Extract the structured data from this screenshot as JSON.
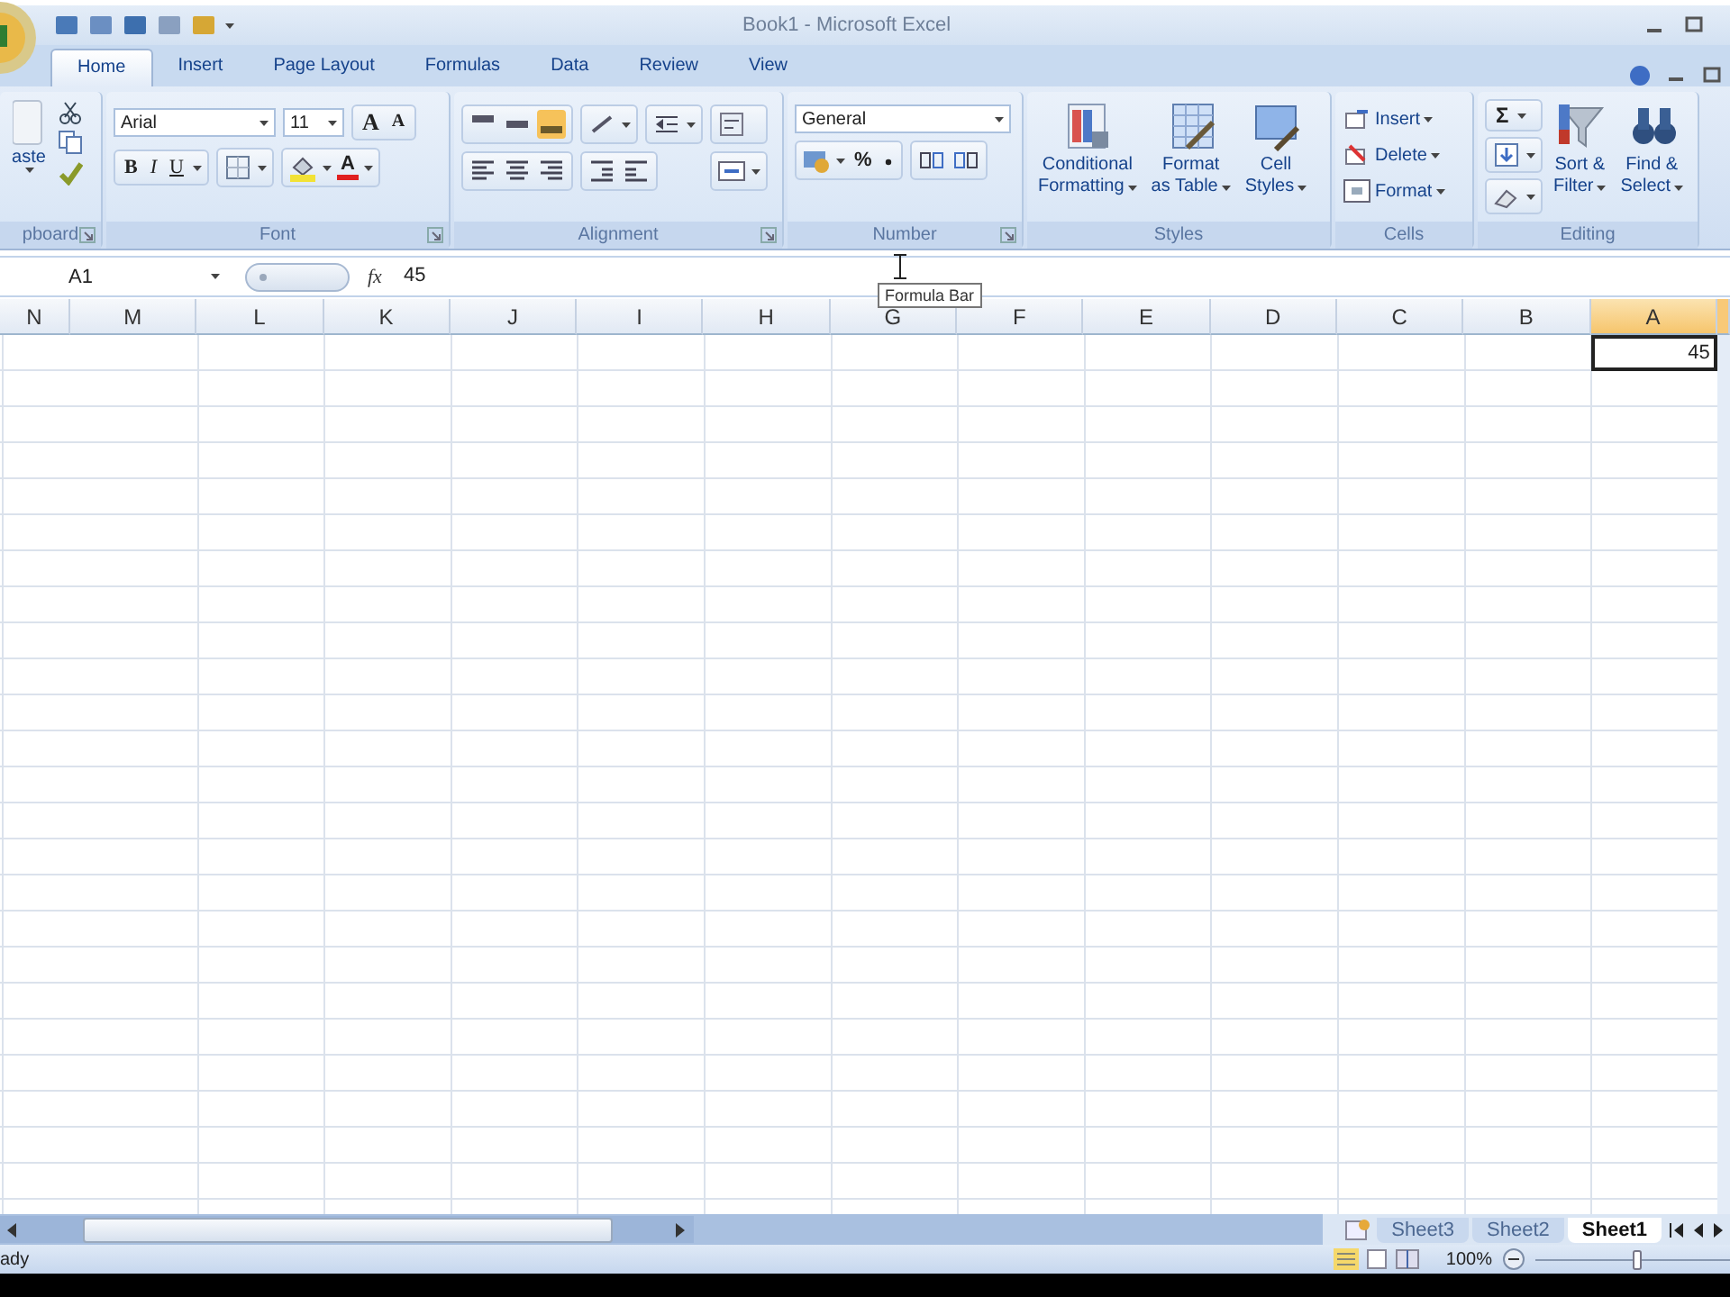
{
  "window": {
    "title": "Book1 - Microsoft Excel"
  },
  "ribbon_tabs": [
    {
      "label": "Home",
      "selected": true
    },
    {
      "label": "Insert",
      "selected": false
    },
    {
      "label": "Page Layout",
      "selected": false
    },
    {
      "label": "Formulas",
      "selected": false
    },
    {
      "label": "Data",
      "selected": false
    },
    {
      "label": "Review",
      "selected": false
    },
    {
      "label": "View",
      "selected": false
    }
  ],
  "clipboard": {
    "paste_label": "aste",
    "group_label": "pboard"
  },
  "font": {
    "name": "Arial",
    "size": "11",
    "grow": "A",
    "shrink": "A",
    "bold": "B",
    "italic": "I",
    "underline": "U",
    "font_color": "A",
    "group_label": "Font"
  },
  "alignment": {
    "group_label": "Alignment"
  },
  "number": {
    "format": "General",
    "percent": "%",
    "group_label": "Number"
  },
  "styles": {
    "buttons": [
      {
        "lines": [
          "Conditional",
          "Formatting"
        ]
      },
      {
        "lines": [
          "Format",
          "as Table"
        ]
      },
      {
        "lines": [
          "Cell",
          "Styles"
        ]
      }
    ],
    "group_label": "Styles"
  },
  "cells": {
    "buttons": [
      "Insert",
      "Delete",
      "Format"
    ],
    "group_label": "Cells"
  },
  "editing": {
    "sum": "Σ",
    "buttons": [
      {
        "lines": [
          "Sort &",
          "Filter"
        ]
      },
      {
        "lines": [
          "Find &",
          "Select"
        ]
      }
    ],
    "group_label": "Editing"
  },
  "formula_bar": {
    "name_box": "A1",
    "fx": "fx",
    "value": "45"
  },
  "tooltip": "Formula Bar",
  "columns": [
    {
      "label": "N",
      "selected": false
    },
    {
      "label": "M",
      "selected": false
    },
    {
      "label": "L",
      "selected": false
    },
    {
      "label": "K",
      "selected": false
    },
    {
      "label": "J",
      "selected": false
    },
    {
      "label": "I",
      "selected": false
    },
    {
      "label": "H",
      "selected": false
    },
    {
      "label": "G",
      "selected": false
    },
    {
      "label": "F",
      "selected": false
    },
    {
      "label": "E",
      "selected": false
    },
    {
      "label": "D",
      "selected": false
    },
    {
      "label": "C",
      "selected": false
    },
    {
      "label": "B",
      "selected": false
    },
    {
      "label": "A",
      "selected": true
    }
  ],
  "active_cell": {
    "value": "45"
  },
  "sheet_tabs": [
    {
      "label": "Sheet3",
      "selected": false
    },
    {
      "label": "Sheet2",
      "selected": false
    },
    {
      "label": "Sheet1",
      "selected": true
    }
  ],
  "status_bar": {
    "text": "ady",
    "zoom": "100%",
    "zoom_slider": {
      "level": 0.5
    }
  }
}
